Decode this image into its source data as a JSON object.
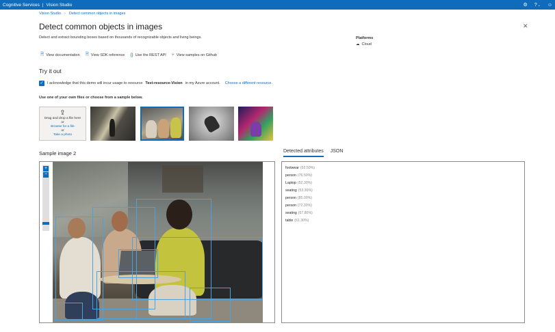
{
  "topbar": {
    "product": "Cognitive Services",
    "separator": "|",
    "app": "Vision Studio",
    "settings_icon": "gear-icon",
    "help_icon": "question-icon",
    "help_chevron_icon": "chevron-down-icon",
    "account_icon": "smiley-icon"
  },
  "breadcrumb": {
    "root": "Vision Studio",
    "current": "Detect common objects in images"
  },
  "page": {
    "title": "Detect common objects in images",
    "description": "Detect and extract bounding boxes based on thousands of recognizable objects and living beings.",
    "close_icon": "close-icon"
  },
  "platforms": {
    "label": "Platforms",
    "value": "Cloud",
    "icon": "cloud-icon"
  },
  "links": [
    {
      "label": "View documentation",
      "icon": "document-icon"
    },
    {
      "label": "View SDK reference",
      "icon": "document-icon"
    },
    {
      "label": "Use the REST API",
      "icon": "code-braces-icon"
    },
    {
      "label": "View samples on Github",
      "icon": "branch-icon"
    }
  ],
  "try_it_out": {
    "title": "Try it out",
    "ack_prefix": "I acknowledge that this demo will incur usage to resource",
    "resource": "Test-resource-Vision",
    "ack_suffix": "in my Azure account.",
    "change_resource": "Choose a different resource.",
    "use_label": "Use one of your own files or choose from a sample below."
  },
  "upload": {
    "line1": "Drag and drop a file here",
    "or1": "or",
    "browse": "Browse for a file",
    "or2": "or",
    "take_photo": "Take a photo"
  },
  "sample": {
    "title": "Sample image 2"
  },
  "tabs": [
    {
      "label": "Detected attributes",
      "active": true
    },
    {
      "label": "JSON",
      "active": false
    }
  ],
  "zoom": {
    "plus": "+",
    "minus": "−"
  },
  "detected": [
    {
      "label": "footwear",
      "pct": "(52.50%)"
    },
    {
      "label": "person",
      "pct": "(76.50%)"
    },
    {
      "label": "Laptop",
      "pct": "(52.30%)"
    },
    {
      "label": "seating",
      "pct": "(53.30%)"
    },
    {
      "label": "person",
      "pct": "(85.00%)"
    },
    {
      "label": "person",
      "pct": "(72.30%)"
    },
    {
      "label": "seating",
      "pct": "(67.80%)"
    },
    {
      "label": "table",
      "pct": "(61.30%)"
    }
  ],
  "colors": {
    "accent": "#0f6cbd",
    "bounding_box": "#4aa3e0"
  }
}
